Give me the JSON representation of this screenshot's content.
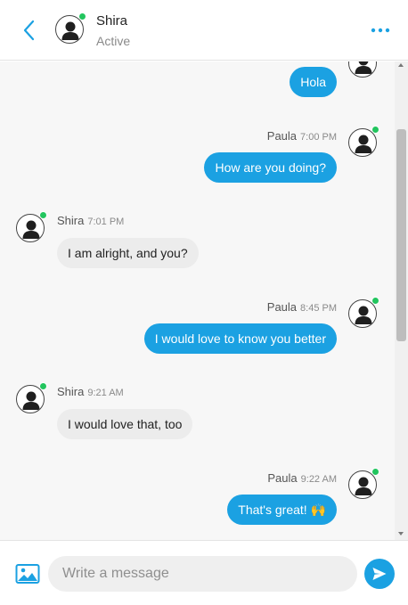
{
  "header": {
    "contact_name": "Shira",
    "contact_status": "Active",
    "icons": {
      "back": "chevron-left-icon",
      "more": "more-horizontal-icon",
      "avatar": "user-avatar-icon"
    }
  },
  "messages": [
    {
      "sender": "Paula",
      "time": "",
      "text": "Hola",
      "direction": "outgoing",
      "partially_visible": true
    },
    {
      "sender": "Paula",
      "time": "7:00 PM",
      "text": "How are you doing?",
      "direction": "outgoing"
    },
    {
      "sender": "Shira",
      "time": "7:01 PM",
      "text": "I am alright, and you?",
      "direction": "incoming"
    },
    {
      "sender": "Paula",
      "time": "8:45 PM",
      "text": "I would love to know you better",
      "direction": "outgoing"
    },
    {
      "sender": "Shira",
      "time": "9:21 AM",
      "text": "I would love that, too",
      "direction": "incoming"
    },
    {
      "sender": "Paula",
      "time": "9:22 AM",
      "text": "That's great! 🙌",
      "direction": "outgoing"
    }
  ],
  "composer": {
    "placeholder": "Write a message",
    "value": "",
    "icons": {
      "attach": "image-icon",
      "send": "send-icon"
    }
  },
  "colors": {
    "accent": "#1ba1e2",
    "online": "#22c55e",
    "incoming_bubble": "#ececec",
    "chat_background": "#f7f7f7"
  }
}
